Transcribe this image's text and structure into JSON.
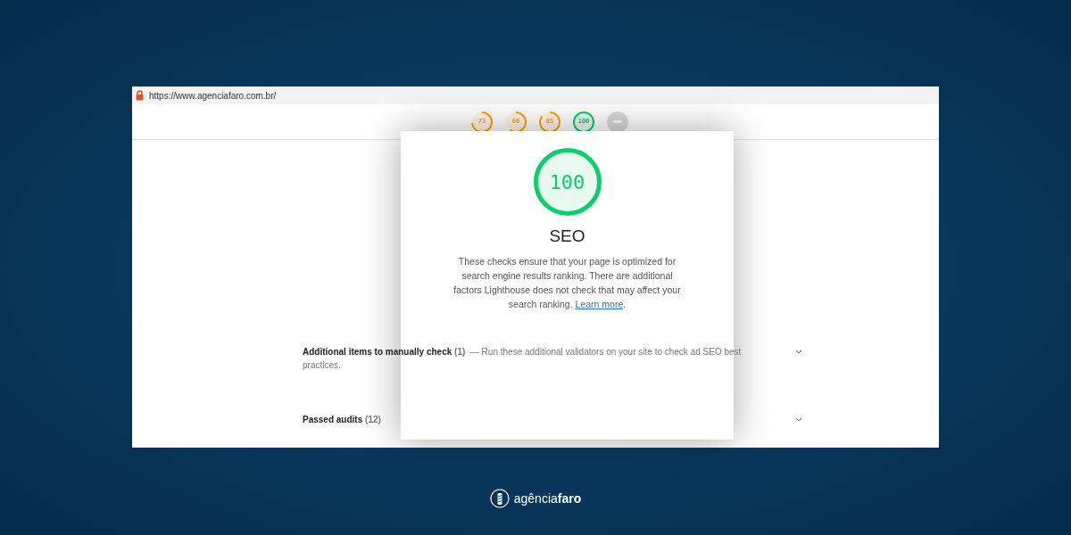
{
  "address_bar": {
    "url": "https://www.agenciafaro.com.br/"
  },
  "gauges": [
    {
      "kind": "score",
      "label": "73",
      "level": 0.73
    },
    {
      "kind": "score",
      "label": "60",
      "level": 0.6
    },
    {
      "kind": "score",
      "label": "85",
      "level": 0.85
    },
    {
      "kind": "score",
      "label": "100",
      "level": 1
    },
    {
      "kind": "pwa"
    }
  ],
  "category": {
    "score": "100",
    "level": 1,
    "title": "SEO",
    "description": "These checks ensure that your page is optimized for search engine results ranking. There are additional factors Lighthouse does not check that may affect your search ranking.",
    "link": "Learn more",
    "after_link": "."
  },
  "sections": [
    {
      "title": "Additional items to manually check",
      "count": "(1)",
      "description": "— Run these additional validators on your site to check ad SEO best practices.",
      "expanded": false
    },
    {
      "title": "Passed audits",
      "count": "(12)",
      "expanded": false
    }
  ],
  "footer_logo": {
    "text": "agência**faro**"
  }
}
